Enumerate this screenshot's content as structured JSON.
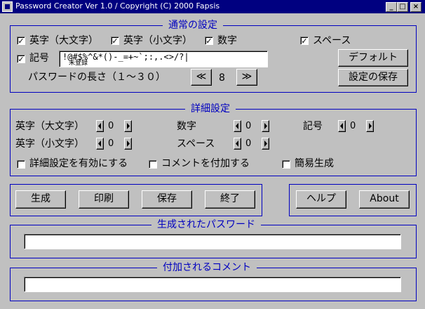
{
  "window": {
    "title": "Password Creator Ver 1.0  /  Copyright (C) 2000 Fapsis"
  },
  "title_buttons": {
    "minimize": "_",
    "maximize": "□",
    "close": "×"
  },
  "normal": {
    "title": "通常の設定",
    "upper": {
      "label": "英字（大文字）",
      "checked": "✓"
    },
    "lower": {
      "label": "英字（小文字）",
      "checked": "✓"
    },
    "digits": {
      "label": "数字",
      "checked": "✓"
    },
    "space": {
      "label": "スペース",
      "checked": "✓"
    },
    "symbol": {
      "label": "記号",
      "checked": "✓",
      "value": "!@#$%^&*()-_=+~`;:,.<>/?|",
      "hint": "未登録"
    },
    "default_button": "デフォルト",
    "length_label": "パスワードの長さ（１～３０）",
    "length_dec": "≪",
    "length_value": "8",
    "length_inc": "≫",
    "save_button": "設定の保存"
  },
  "detail": {
    "title": "詳細設定",
    "upper": {
      "label": "英字（大文字）",
      "value": "0"
    },
    "lower": {
      "label": "英字（小文字）",
      "value": "0"
    },
    "digits": {
      "label": "数字",
      "value": "0"
    },
    "space": {
      "label": "スペース",
      "value": "0"
    },
    "symbol": {
      "label": "記号",
      "value": "0"
    },
    "enable_label": "詳細設定を有効にする",
    "comment_label": "コメントを付加する",
    "simple_label": "簡易生成"
  },
  "actions": {
    "generate": "生成",
    "print": "印刷",
    "save": "保存",
    "exit": "終了",
    "help": "ヘルプ",
    "about": "About"
  },
  "output": {
    "password_title": "生成されたパスワード",
    "password_value": "",
    "comment_title": "付加されるコメント",
    "comment_value": ""
  }
}
